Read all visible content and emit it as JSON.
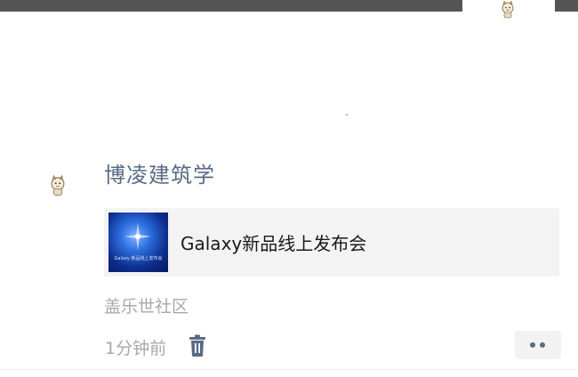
{
  "post": {
    "author": "博凌建筑学",
    "card": {
      "title": "Galaxy新品线上发布会",
      "thumb_caption": "Galaxy 新品线上发布会",
      "thumb_subcaption": ""
    },
    "source": "盖乐世社区",
    "time": "1分钟前"
  },
  "icons": {
    "avatar": "mascot-avatar-icon",
    "delete": "trash-icon",
    "more": "more-dots-icon"
  },
  "colors": {
    "name_blue": "#586b84",
    "meta_gray": "#a8a8a8",
    "card_bg": "#f3f3f3"
  }
}
